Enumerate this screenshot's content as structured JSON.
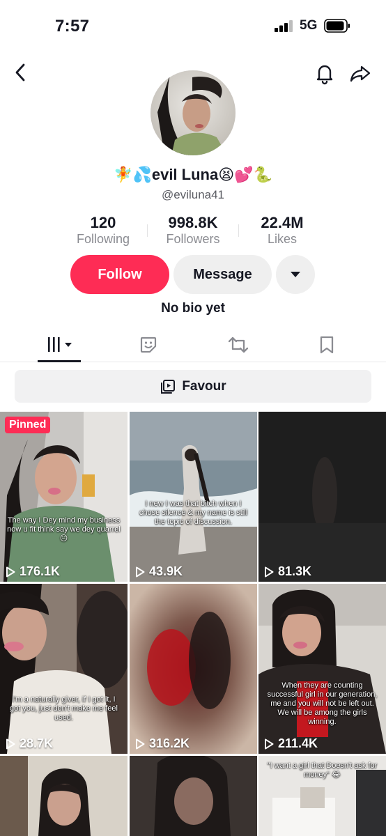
{
  "status": {
    "time": "7:57",
    "network": "5G"
  },
  "profile": {
    "display_name": "🧚💦evil Luna😫💕🐍",
    "username": "@eviluna41",
    "bio": "No bio yet"
  },
  "stats": [
    {
      "value": "120",
      "label": "Following"
    },
    {
      "value": "998.8K",
      "label": "Followers"
    },
    {
      "value": "22.4M",
      "label": "Likes"
    }
  ],
  "actions": {
    "follow": "Follow",
    "message": "Message"
  },
  "tabs": [
    {
      "icon": "videos-grid-icon",
      "active": true
    },
    {
      "icon": "favorites-sticker-icon",
      "active": false
    },
    {
      "icon": "repost-icon",
      "active": false
    },
    {
      "icon": "bookmark-icon",
      "active": false
    }
  ],
  "playlist": {
    "label": "Favour",
    "icon": "playlist-icon"
  },
  "videos": [
    {
      "views": "176.1K",
      "pinned": "Pinned",
      "caption": "The way I Dey mind my business now u fit think say we dey quarrel 😑"
    },
    {
      "views": "43.9K",
      "caption": "I new I was that bitch when I chose silence & my name is still the topic of discussion."
    },
    {
      "views": "81.3K",
      "caption": ""
    },
    {
      "views": "28.7K",
      "caption": "I'm a naturally giver, if I got it, I got you, just don't make me feel used."
    },
    {
      "views": "316.2K",
      "caption": ""
    },
    {
      "views": "211.4K",
      "caption": "When they are counting successful girl in our generation, me and you will not be left out. We will be among the girls winning."
    },
    {
      "views": "",
      "caption": ""
    },
    {
      "views": "",
      "caption": ""
    },
    {
      "views": "",
      "caption": "\"I want a girl that Doesn't ask for money\" 😂"
    }
  ],
  "colors": {
    "accent": "#fe2c55",
    "text": "#161823",
    "secondary": "#8a8b91"
  }
}
